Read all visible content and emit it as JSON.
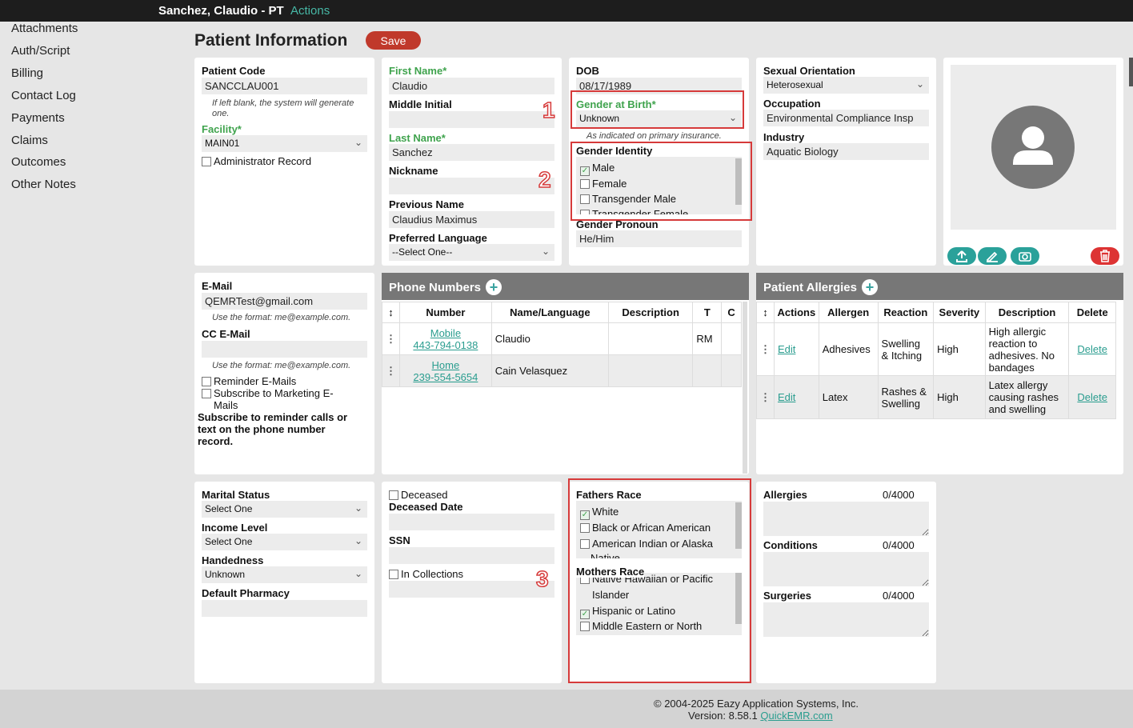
{
  "header": {
    "patient_name": "Sanchez, Claudio - PT",
    "actions_label": "Actions"
  },
  "sidebar": {
    "items": [
      "Attachments",
      "Auth/Script",
      "Billing",
      "Contact Log",
      "Payments",
      "Claims",
      "Outcomes",
      "Other Notes"
    ]
  },
  "page": {
    "title": "Patient Information",
    "save_label": "Save"
  },
  "card1": {
    "patient_code_label": "Patient Code",
    "patient_code_value": "SANCCLAU001",
    "patient_code_hint": "If left blank, the system will generate one.",
    "facility_label": "Facility*",
    "facility_value": "MAIN01",
    "admin_record_label": "Administrator Record"
  },
  "card2": {
    "first_name_label": "First Name*",
    "first_name_value": "Claudio",
    "middle_initial_label": "Middle Initial",
    "middle_initial_value": "",
    "last_name_label": "Last Name*",
    "last_name_value": "Sanchez",
    "nickname_label": "Nickname",
    "nickname_value": "",
    "previous_name_label": "Previous Name",
    "previous_name_value": "Claudius Maximus",
    "language_label": "Preferred Language",
    "language_value": "--Select One--"
  },
  "card3": {
    "dob_label": "DOB",
    "dob_value": "08/17/1989",
    "gender_birth_label": "Gender at Birth*",
    "gender_birth_value": "Unknown",
    "gender_birth_hint": "As indicated on primary insurance.",
    "gender_identity_label": "Gender Identity",
    "gender_identity_options": [
      "Male",
      "Female",
      "Transgender Male",
      "Transgender Female"
    ],
    "gender_pronoun_label": "Gender Pronoun",
    "gender_pronoun_value": "He/Him"
  },
  "card4": {
    "orientation_label": "Sexual Orientation",
    "orientation_value": "Heterosexual",
    "occupation_label": "Occupation",
    "occupation_value": "Environmental Compliance Insp",
    "industry_label": "Industry",
    "industry_value": "Aquatic Biology"
  },
  "email_card": {
    "email_label": "E-Mail",
    "email_value": "QEMRTest@gmail.com",
    "email_hint": "Use the format: me@example.com.",
    "cc_label": "CC E-Mail",
    "cc_value": "",
    "cc_hint": "Use the format: me@example.com.",
    "reminder_label": "Reminder E-Mails",
    "marketing_label_1": "Subscribe to Marketing E-",
    "marketing_label_2": "Mails",
    "subscribe_note_1": "Subscribe to reminder calls or",
    "subscribe_note_2": "text on the phone number",
    "subscribe_note_3": "record."
  },
  "phones": {
    "title": "Phone Numbers",
    "columns": [
      "Number",
      "Name/Language",
      "Description",
      "T",
      "C"
    ],
    "rows": [
      {
        "type": "Mobile",
        "number": "443-794-0138",
        "name": "Claudio",
        "description": "",
        "t": "RM",
        "c": ""
      },
      {
        "type": "Home",
        "number": "239-554-5654",
        "name": "Cain Velasquez",
        "description": "",
        "t": "",
        "c": ""
      }
    ]
  },
  "allergies_panel": {
    "title": "Patient Allergies",
    "columns": [
      "Actions",
      "Allergen",
      "Reaction",
      "Severity",
      "Description",
      "Delete"
    ],
    "rows": [
      {
        "action": "Edit",
        "allergen": "Adhesives",
        "reaction_1": "Swelling",
        "reaction_2": "& Itching",
        "severity": "High",
        "desc_1": "High allergic",
        "desc_2": "reaction to",
        "desc_3": "adhesives. No",
        "desc_4": "bandages",
        "delete": "Delete"
      },
      {
        "action": "Edit",
        "allergen": "Latex",
        "reaction_1": "Rashes &",
        "reaction_2": "Swelling",
        "severity": "High",
        "desc_1": "Latex allergy",
        "desc_2": "causing rashes",
        "desc_3": "and swelling",
        "desc_4": "",
        "delete": "Delete"
      }
    ]
  },
  "social_card": {
    "marital_label": "Marital Status",
    "marital_value": "Select One",
    "income_label": "Income Level",
    "income_value": "Select One",
    "handedness_label": "Handedness",
    "handedness_value": "Unknown",
    "pharmacy_label": "Default Pharmacy",
    "pharmacy_value": ""
  },
  "deceased_card": {
    "deceased_label": "Deceased",
    "deceased_date_label": "Deceased Date",
    "ssn_label": "SSN",
    "collections_label": "In Collections"
  },
  "race_card": {
    "fathers_label": "Fathers Race",
    "fathers_options": [
      "White",
      "Black or African American",
      "American Indian or Alaska",
      "Native"
    ],
    "mothers_label": "Mothers Race",
    "mothers_options": [
      "Native Hawaiian or Pacific",
      "Islander",
      "Hispanic or Latino",
      "Middle Eastern or North"
    ]
  },
  "notes_card": {
    "allergies_label": "Allergies",
    "allergies_count": "0/4000",
    "conditions_label": "Conditions",
    "conditions_count": "0/4000",
    "surgeries_label": "Surgeries",
    "surgeries_count": "0/4000"
  },
  "annotations": [
    "1",
    "2",
    "3"
  ],
  "footer": {
    "copyright": "© 2004-2025 Eazy Application Systems, Inc.",
    "version": "Version: 8.58.1",
    "link": "QuickEMR.com"
  },
  "colors": {
    "accent": "#2aa19a",
    "required_label": "#3fa34d",
    "save": "#c0392b",
    "annotation": "#d63a3a"
  },
  "icons": [
    "chevron-down-icon",
    "plus-icon",
    "drag-handle-icon",
    "sort-icon",
    "user-silhouette-icon",
    "upload-icon",
    "pen-icon",
    "camera-icon",
    "trash-icon"
  ]
}
